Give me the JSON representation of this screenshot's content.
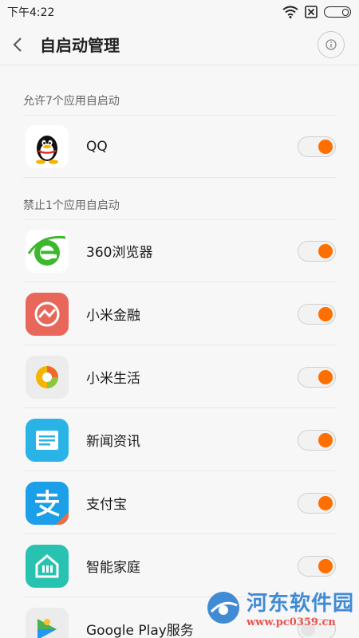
{
  "status_bar": {
    "time": "下午4:22"
  },
  "header": {
    "title": "自启动管理"
  },
  "sections": [
    {
      "title": "允许7个应用自启动",
      "apps": [
        {
          "name": "QQ",
          "enabled": true
        }
      ]
    },
    {
      "title": "禁止1个应用自启动",
      "apps": [
        {
          "name": "360浏览器",
          "enabled": true
        },
        {
          "name": "小米金融",
          "enabled": true
        },
        {
          "name": "小米生活",
          "enabled": true
        },
        {
          "name": "新闻资讯",
          "enabled": true
        },
        {
          "name": "支付宝",
          "enabled": true
        },
        {
          "name": "智能家庭",
          "enabled": true
        },
        {
          "name": "Google Play服务",
          "enabled": false
        }
      ]
    }
  ],
  "watermark": {
    "name": "河东软件园",
    "url": "www.pc0359.cn"
  },
  "colors": {
    "toggle_on": "#ff6f00",
    "background": "#f7f7f7"
  }
}
